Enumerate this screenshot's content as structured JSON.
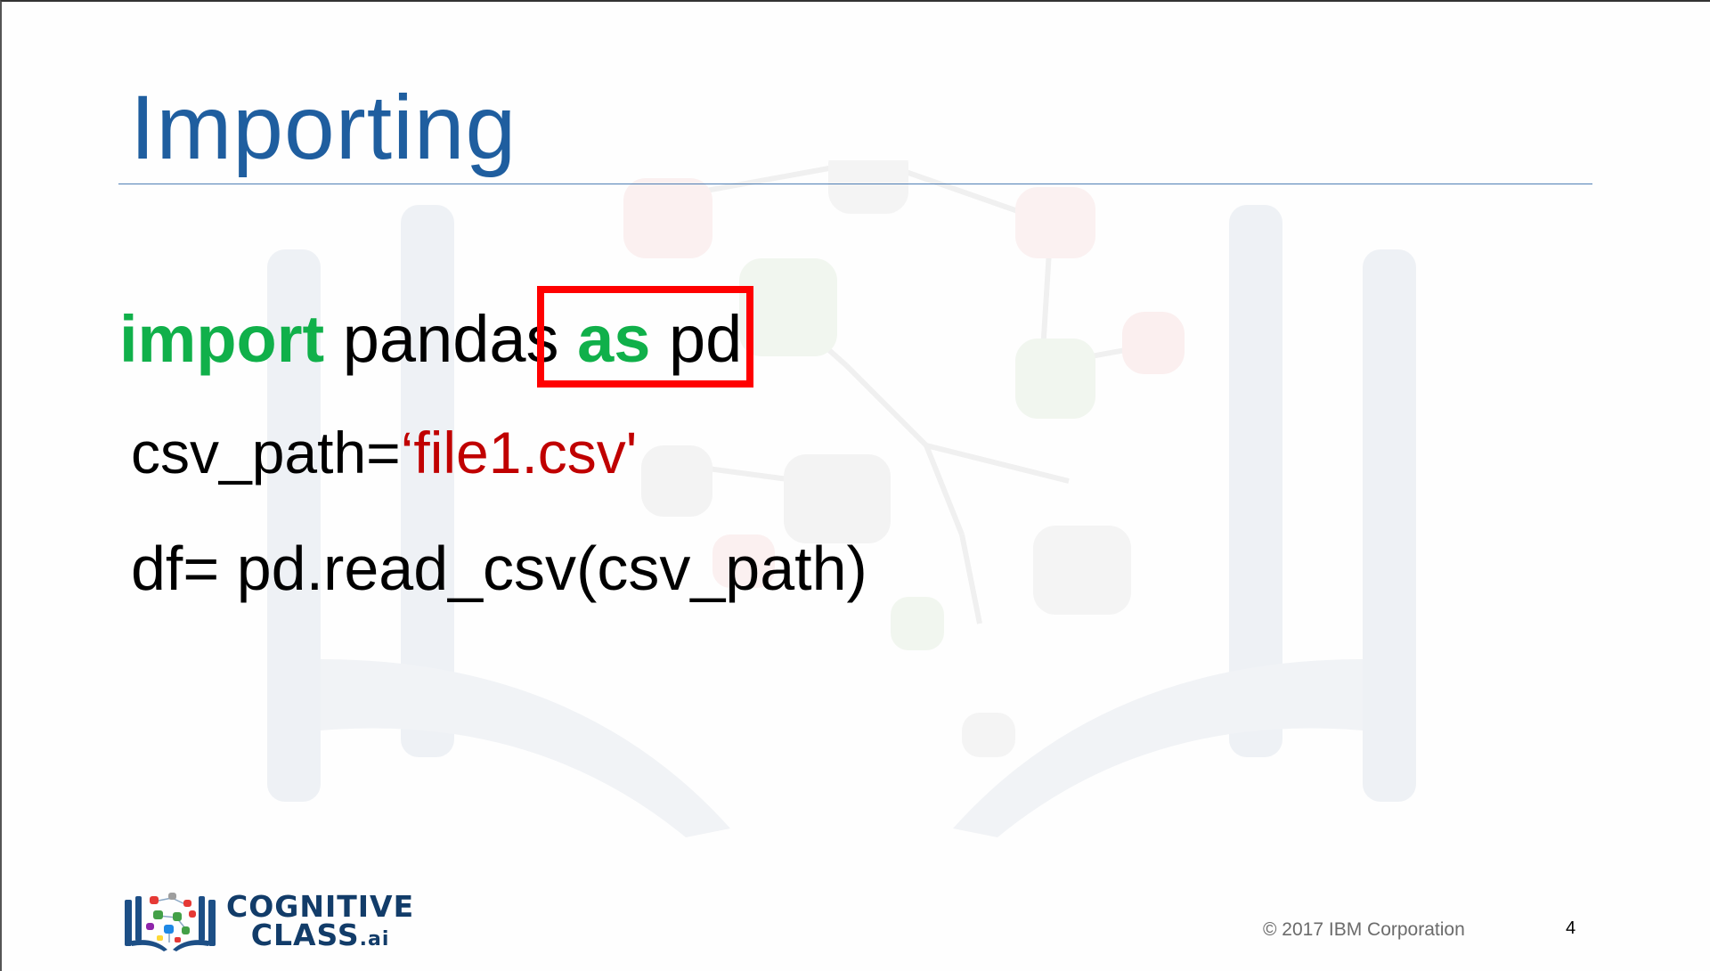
{
  "slide": {
    "title": "Importing",
    "code": {
      "line1": {
        "kw_import": "import",
        "module": " pandas",
        "kw_as": " as",
        "alias": " pd"
      },
      "line2": {
        "lhs": "csv_path=",
        "string": "‘file1.csv'"
      },
      "line3": {
        "text": "df= pd.read_csv(csv_path)"
      }
    },
    "highlight": {
      "color": "#ff0000"
    },
    "logo": {
      "line1": "COGNITIVE",
      "line2": "CLASS",
      "suffix": ".ai"
    },
    "footer": {
      "copyright": "© 2017 IBM Corporation",
      "page_number": "4"
    }
  },
  "colors": {
    "title": "#1f5e9f",
    "keyword": "#10b04a",
    "string": "#c00000",
    "logo": "#123c69"
  }
}
